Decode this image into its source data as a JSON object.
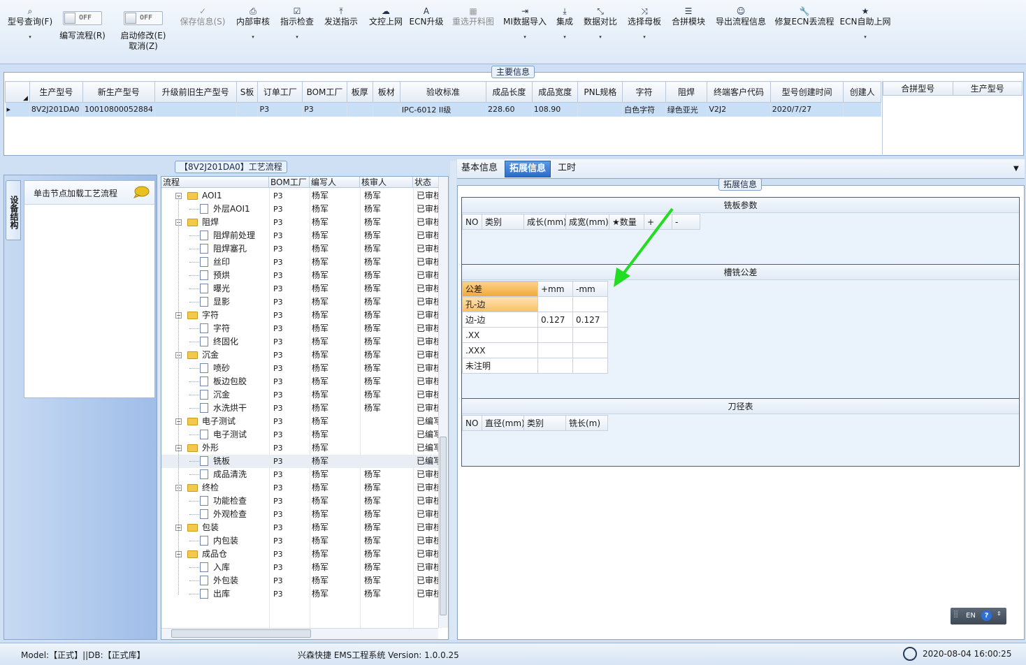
{
  "toolbar": {
    "items": [
      {
        "icon": "search-icon",
        "label": "型号查询(F)",
        "caret": "▾"
      },
      {
        "icon": "toggle",
        "label": "编写流程(R)",
        "toggle": "OFF"
      },
      {
        "icon": "toggle",
        "label": "启动修改(E)",
        "label2": "取消(Z)",
        "toggle": "OFF"
      },
      {
        "icon": "check-icon",
        "label": "保存信息(S)"
      },
      {
        "icon": "printer-icon",
        "label": "内部审核",
        "caret": "▾"
      },
      {
        "icon": "checkbox-icon",
        "label": "指示检查",
        "caret": "▾"
      },
      {
        "icon": "upload-icon",
        "label": "发送指示"
      },
      {
        "icon": "cloud-upload-icon",
        "label": "文控上网"
      },
      {
        "icon": "ecn-icon",
        "label": "ECN升级"
      },
      {
        "icon": "image-icon",
        "label": "重选开料图"
      },
      {
        "icon": "import-icon",
        "label": "MI数据导入",
        "caret": "▾"
      },
      {
        "icon": "download-icon",
        "label": "集成",
        "caret": "▾"
      },
      {
        "icon": "compress-icon",
        "label": "数据对比",
        "caret": "▾"
      },
      {
        "icon": "shuffle-icon",
        "label": "选择母板",
        "caret": "▾"
      },
      {
        "icon": "list-icon",
        "label": "合拼模块"
      },
      {
        "icon": "smile-icon",
        "label": "导出流程信息"
      },
      {
        "icon": "wrench-icon",
        "label": "修复ECN丢流程"
      },
      {
        "icon": "star-icon",
        "label": "ECN自助上网",
        "caret": "▾"
      }
    ]
  },
  "main_info": {
    "title": "主要信息",
    "columns": [
      "生产型号",
      "新生产型号",
      "升级前旧生产型号",
      "S板",
      "订单工厂",
      "BOM工厂",
      "板厚",
      "板材",
      "验收标准",
      "成品长度",
      "成品宽度",
      "PNL规格",
      "字符",
      "阻焊",
      "终端客户代码",
      "型号创建时间",
      "创建人"
    ],
    "rows": [
      [
        "8V2J201DA0",
        "10010800052884",
        "",
        "",
        "P3",
        "P3",
        "",
        "",
        "IPC-6012 II级",
        "228.60",
        "108.90",
        "",
        "白色字符",
        "绿色亚光",
        "V2J2",
        "2020/7/27",
        ""
      ]
    ],
    "merge_columns": [
      "合拼型号",
      "生产型号"
    ]
  },
  "left_panel": {
    "tab": "设备结构",
    "hint": "单击节点加载工艺流程"
  },
  "process_flow": {
    "title": "【8V2J201DA0】工艺流程",
    "columns": [
      "流程",
      "BOM工厂",
      "编写人",
      "核审人",
      "状态"
    ],
    "rows": [
      {
        "level": 0,
        "name": "AOI1",
        "bom": "P3",
        "writer": "杨军",
        "reviewer": "杨军",
        "status": "已审核"
      },
      {
        "level": 1,
        "name": "外层AOI1",
        "bom": "P3",
        "writer": "杨军",
        "reviewer": "杨军",
        "status": "已审核"
      },
      {
        "level": 0,
        "name": "阻焊",
        "bom": "P3",
        "writer": "杨军",
        "reviewer": "杨军",
        "status": "已审核"
      },
      {
        "level": 1,
        "name": "阻焊前处理",
        "bom": "P3",
        "writer": "杨军",
        "reviewer": "杨军",
        "status": "已审核"
      },
      {
        "level": 1,
        "name": "阻焊塞孔",
        "bom": "P3",
        "writer": "杨军",
        "reviewer": "杨军",
        "status": "已审核"
      },
      {
        "level": 1,
        "name": "丝印",
        "bom": "P3",
        "writer": "杨军",
        "reviewer": "杨军",
        "status": "已审核"
      },
      {
        "level": 1,
        "name": "预烘",
        "bom": "P3",
        "writer": "杨军",
        "reviewer": "杨军",
        "status": "已审核"
      },
      {
        "level": 1,
        "name": "曝光",
        "bom": "P3",
        "writer": "杨军",
        "reviewer": "杨军",
        "status": "已审核"
      },
      {
        "level": 1,
        "name": "显影",
        "bom": "P3",
        "writer": "杨军",
        "reviewer": "杨军",
        "status": "已审核"
      },
      {
        "level": 0,
        "name": "字符",
        "bom": "P3",
        "writer": "杨军",
        "reviewer": "杨军",
        "status": "已审核"
      },
      {
        "level": 1,
        "name": "字符",
        "bom": "P3",
        "writer": "杨军",
        "reviewer": "杨军",
        "status": "已审核"
      },
      {
        "level": 1,
        "name": "终固化",
        "bom": "P3",
        "writer": "杨军",
        "reviewer": "杨军",
        "status": "已审核"
      },
      {
        "level": 0,
        "name": "沉金",
        "bom": "P3",
        "writer": "杨军",
        "reviewer": "杨军",
        "status": "已审核"
      },
      {
        "level": 1,
        "name": "喷砂",
        "bom": "P3",
        "writer": "杨军",
        "reviewer": "杨军",
        "status": "已审核"
      },
      {
        "level": 1,
        "name": "板边包胶",
        "bom": "P3",
        "writer": "杨军",
        "reviewer": "杨军",
        "status": "已审核"
      },
      {
        "level": 1,
        "name": "沉金",
        "bom": "P3",
        "writer": "杨军",
        "reviewer": "杨军",
        "status": "已审核"
      },
      {
        "level": 1,
        "name": "水洗烘干",
        "bom": "P3",
        "writer": "杨军",
        "reviewer": "杨军",
        "status": "已审核"
      },
      {
        "level": 0,
        "name": "电子测试",
        "bom": "P3",
        "writer": "杨军",
        "reviewer": "",
        "status": "已编写"
      },
      {
        "level": 1,
        "name": "电子测试",
        "bom": "P3",
        "writer": "杨军",
        "reviewer": "",
        "status": "已编写"
      },
      {
        "level": 0,
        "name": "外形",
        "bom": "P3",
        "writer": "杨军",
        "reviewer": "",
        "status": "已编写"
      },
      {
        "level": 1,
        "name": "铣板",
        "bom": "P3",
        "writer": "杨军",
        "reviewer": "",
        "status": "已编写",
        "selected": true
      },
      {
        "level": 1,
        "name": "成品清洗",
        "bom": "P3",
        "writer": "杨军",
        "reviewer": "杨军",
        "status": "已审核"
      },
      {
        "level": 0,
        "name": "终检",
        "bom": "P3",
        "writer": "杨军",
        "reviewer": "杨军",
        "status": "已审核"
      },
      {
        "level": 1,
        "name": "功能检查",
        "bom": "P3",
        "writer": "杨军",
        "reviewer": "杨军",
        "status": "已审核"
      },
      {
        "level": 1,
        "name": "外观检查",
        "bom": "P3",
        "writer": "杨军",
        "reviewer": "杨军",
        "status": "已审核"
      },
      {
        "level": 0,
        "name": "包装",
        "bom": "P3",
        "writer": "杨军",
        "reviewer": "杨军",
        "status": "已审核"
      },
      {
        "level": 1,
        "name": "内包装",
        "bom": "P3",
        "writer": "杨军",
        "reviewer": "杨军",
        "status": "已审核"
      },
      {
        "level": 0,
        "name": "成品仓",
        "bom": "P3",
        "writer": "杨军",
        "reviewer": "杨军",
        "status": "已审核"
      },
      {
        "level": 1,
        "name": "入库",
        "bom": "P3",
        "writer": "杨军",
        "reviewer": "杨军",
        "status": "已审核"
      },
      {
        "level": 1,
        "name": "外包装",
        "bom": "P3",
        "writer": "杨军",
        "reviewer": "杨军",
        "status": "已审核"
      },
      {
        "level": 1,
        "name": "出库",
        "bom": "P3",
        "writer": "杨军",
        "reviewer": "杨军",
        "status": "已审核"
      }
    ]
  },
  "right_panel": {
    "tabs": [
      "基本信息",
      "拓展信息",
      "工时"
    ],
    "active_tab": 1,
    "badge": "拓展信息",
    "milling": {
      "title": "铣板参数",
      "columns": [
        "NO",
        "类别",
        "成长(mm)",
        "成宽(mm)",
        "★数量",
        "+",
        "-"
      ]
    },
    "slot_tolerance": {
      "title": "槽铣公差",
      "columns": [
        "公差",
        "+mm",
        "-mm"
      ],
      "rows": [
        [
          "孔-边",
          "",
          ""
        ],
        [
          "边-边",
          "0.127",
          "0.127"
        ],
        [
          ".XX",
          "",
          ""
        ],
        [
          ".XXX",
          "",
          ""
        ],
        [
          "未注明",
          "",
          ""
        ]
      ]
    },
    "tool_table": {
      "title": "刀径表",
      "columns": [
        "NO",
        "直径(mm)",
        "类别",
        "铣长(m)"
      ]
    },
    "ime": {
      "lang": "EN",
      "help": "?"
    }
  },
  "status_bar": {
    "model": "Model:【正式】||DB:【正式库】",
    "app": "兴森快捷 EMS工程系统 Version: 1.0.0.25",
    "datetime": "2020-08-04 16:00:25"
  },
  "colors": {
    "accent": "#3a78c8",
    "arrow": "#22dd22",
    "selection": "#c9dff7"
  }
}
